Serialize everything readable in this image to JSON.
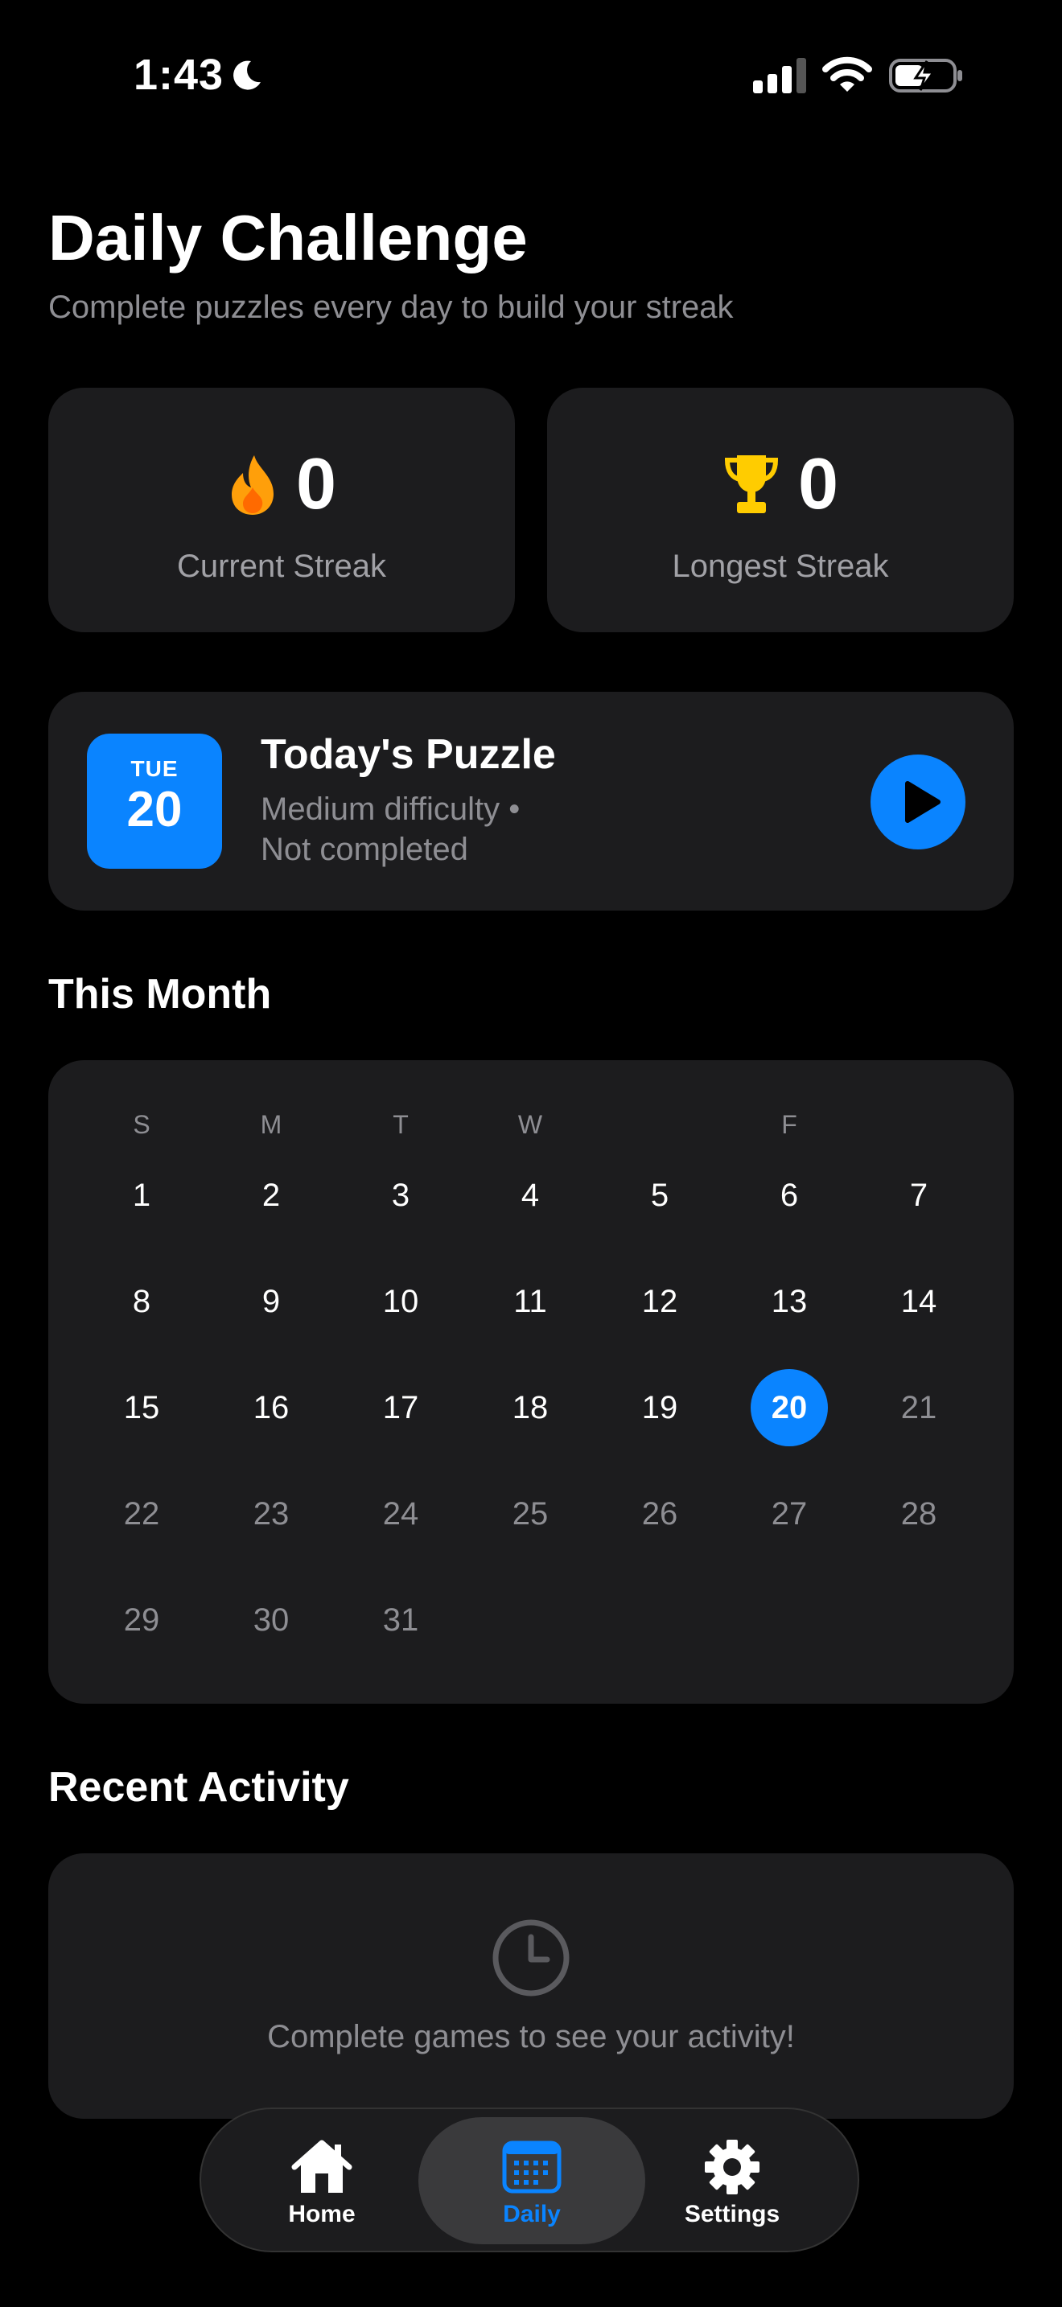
{
  "status_bar": {
    "time": "1:43"
  },
  "header": {
    "title": "Daily Challenge",
    "subtitle": "Complete puzzles every day to build your streak"
  },
  "streaks": {
    "current": {
      "value": "0",
      "label": "Current Streak",
      "icon": "flame-icon",
      "color": "#ff9f0a"
    },
    "longest": {
      "value": "0",
      "label": "Longest Streak",
      "icon": "trophy-icon",
      "color": "#ffcc00"
    }
  },
  "today": {
    "day_of_week": "TUE",
    "day_number": "20",
    "title": "Today's Puzzle",
    "difficulty": "Medium difficulty •",
    "status": "Not completed",
    "accent": "#0a84ff"
  },
  "month": {
    "title": "This Month",
    "weekday_headers": [
      "S",
      "M",
      "T",
      "W",
      "",
      "F",
      ""
    ],
    "days": [
      "1",
      "2",
      "3",
      "4",
      "5",
      "6",
      "7",
      "8",
      "9",
      "10",
      "11",
      "12",
      "13",
      "14",
      "15",
      "16",
      "17",
      "18",
      "19",
      "20",
      "21",
      "22",
      "23",
      "24",
      "25",
      "26",
      "27",
      "28",
      "29",
      "30",
      "31"
    ],
    "today": "20"
  },
  "recent_activity": {
    "title": "Recent Activity",
    "empty_text": "Complete games to see your activity!"
  },
  "tabs": {
    "home": "Home",
    "daily": "Daily",
    "settings": "Settings",
    "active_color": "#0a84ff"
  }
}
